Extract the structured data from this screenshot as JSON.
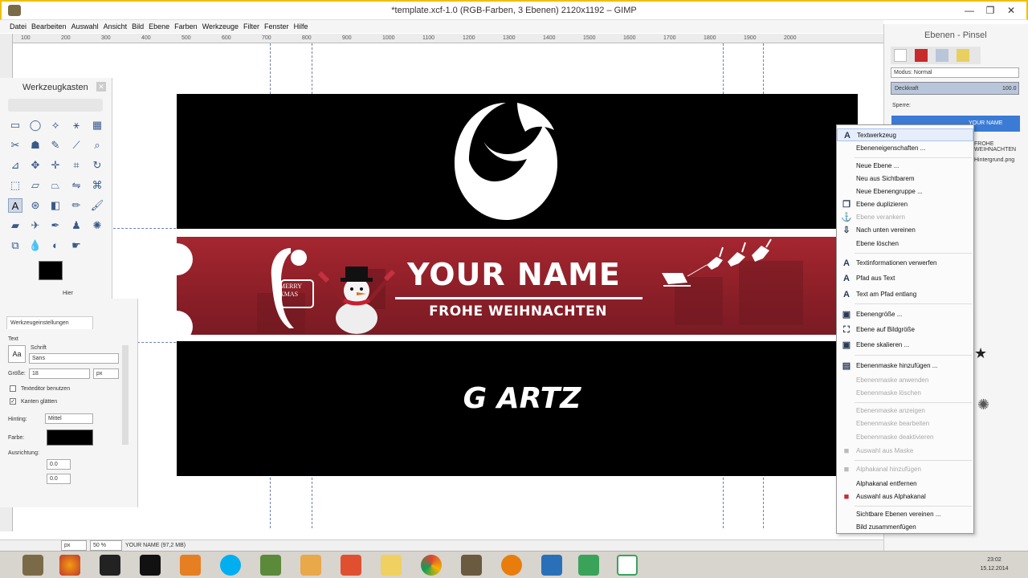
{
  "window": {
    "title": "*template.xcf-1.0 (RGB-Farben, 3 Ebenen) 2120x1192 – GIMP"
  },
  "menubar": [
    "Datei",
    "Bearbeiten",
    "Auswahl",
    "Ansicht",
    "Bild",
    "Ebene",
    "Farben",
    "Werkzeuge",
    "Filter",
    "Fenster",
    "Hilfe"
  ],
  "ruler": {
    "h_ticks": [
      "100",
      "200",
      "300",
      "400",
      "500",
      "600",
      "700",
      "800",
      "900",
      "1000",
      "1100",
      "1200",
      "1300",
      "1400",
      "1500",
      "1600",
      "1700",
      "1800",
      "1900",
      "2000"
    ]
  },
  "image": {
    "name_text": "YOUR NAME",
    "greeting_text": "FROHE WEIHNACHTEN",
    "signature_text": "G ARTZ",
    "badge_text": "MERRY XMAS",
    "colors": {
      "banner": "#8d1f28",
      "band": "#000000"
    }
  },
  "toolbox": {
    "title": "Werkzeugkasten",
    "footer": "Hier"
  },
  "tool_options": {
    "tab_label": "Werkzeugeinstellungen",
    "section": "Text",
    "font_label": "Schrift",
    "font_value": "Sans",
    "size_label": "Größe:",
    "size_value": "18",
    "size_unit": "px",
    "editor_label": "Texteditor benutzen",
    "antialias_label": "Kanten glätten",
    "hinting_label": "Hinting:",
    "hinting_value": "Mittel",
    "color_label": "Farbe:",
    "justify_label": "Ausrichtung:",
    "indent_value": "0.0",
    "spacing_value": "0.0"
  },
  "dock": {
    "title": "Ebenen - Pinsel",
    "mode_label": "Modus: Normal",
    "opacity_label": "Deckkraft",
    "opacity_value": "100.0",
    "lock_label": "Sperre:",
    "layer_selected": "YOUR NAME",
    "layer_2": "FROHE WEIHNACHTEN",
    "layer_3": "Hintergrund.png"
  },
  "context_menu": {
    "items": [
      {
        "label": "Textwerkzeug",
        "icon": "A",
        "state": "highlighted"
      },
      {
        "label": "Ebeneneigenschaften ...",
        "icon": "",
        "state": "enabled"
      },
      {
        "label": "Neue Ebene ...",
        "icon": "",
        "state": "enabled"
      },
      {
        "label": "Neu aus Sichtbarem",
        "icon": "",
        "state": "enabled"
      },
      {
        "label": "Neue Ebenengruppe ...",
        "icon": "",
        "state": "enabled"
      },
      {
        "label": "Ebene duplizieren",
        "icon": "❐",
        "state": "enabled"
      },
      {
        "label": "Ebene verankern",
        "icon": "⚓",
        "state": "disabled"
      },
      {
        "label": "Nach unten vereinen",
        "icon": "⇩",
        "state": "enabled"
      },
      {
        "label": "Ebene löschen",
        "icon": "",
        "state": "enabled"
      },
      {
        "label": "Textinformationen verwerfen",
        "icon": "A",
        "state": "enabled"
      },
      {
        "label": "Pfad aus Text",
        "icon": "A",
        "state": "enabled"
      },
      {
        "label": "Text am Pfad entlang",
        "icon": "A",
        "state": "enabled"
      },
      {
        "label": "Ebenengröße ...",
        "icon": "▣",
        "state": "enabled"
      },
      {
        "label": "Ebene auf Bildgröße",
        "icon": "⛶",
        "state": "enabled"
      },
      {
        "label": "Ebene skalieren ...",
        "icon": "▣",
        "state": "enabled"
      },
      {
        "label": "Ebenenmaske hinzufügen ...",
        "icon": "▤",
        "state": "enabled"
      },
      {
        "label": "Ebenenmaske anwenden",
        "icon": "",
        "state": "disabled"
      },
      {
        "label": "Ebenenmaske löschen",
        "icon": "",
        "state": "disabled"
      },
      {
        "label": "Ebenenmaske anzeigen",
        "icon": "",
        "state": "disabled"
      },
      {
        "label": "Ebenenmaske bearbeiten",
        "icon": "",
        "state": "disabled"
      },
      {
        "label": "Ebenenmaske deaktivieren",
        "icon": "",
        "state": "disabled"
      },
      {
        "label": "Auswahl aus Maske",
        "icon": "■",
        "state": "disabled"
      },
      {
        "label": "Alphakanal hinzufügen",
        "icon": "■",
        "state": "disabled"
      },
      {
        "label": "Alphakanal entfernen",
        "icon": "",
        "state": "enabled"
      },
      {
        "label": "Auswahl aus Alphakanal",
        "icon": "■",
        "state": "enabled"
      },
      {
        "label": "Sichtbare Ebenen vereinen ...",
        "icon": "",
        "state": "enabled"
      },
      {
        "label": "Bild zusammenfügen",
        "icon": "",
        "state": "enabled"
      }
    ]
  },
  "statusbar": {
    "unit": "px",
    "zoom": "50 %",
    "info": "YOUR NAME (97,2 MB)"
  },
  "taskbar": {
    "time": "23:02",
    "date": "15.12.2014"
  }
}
